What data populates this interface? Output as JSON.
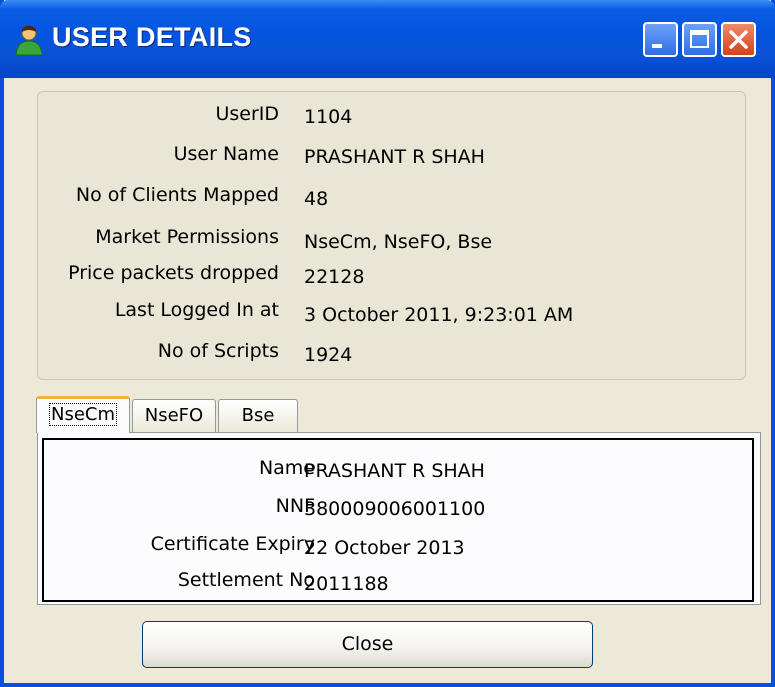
{
  "window": {
    "title": "USER DETAILS"
  },
  "details": [
    {
      "label": "UserID",
      "value": "1104"
    },
    {
      "label": "User Name",
      "value": "PRASHANT R SHAH"
    },
    {
      "label": "No of Clients Mapped",
      "value": "48"
    },
    {
      "label": "Market Permissions",
      "value": "NseCm, NseFO, Bse"
    },
    {
      "label": "Price packets dropped",
      "value": "22128"
    },
    {
      "label": "Last Logged In at",
      "value": "3 October 2011, 9:23:01 AM"
    },
    {
      "label": "No of Scripts",
      "value": "1924"
    }
  ],
  "tabs": [
    {
      "label": "NseCm",
      "active": true
    },
    {
      "label": "NseFO",
      "active": false
    },
    {
      "label": "Bse",
      "active": false
    }
  ],
  "segment": [
    {
      "label": "Name",
      "value": "PRASHANT R SHAH"
    },
    {
      "label": "NNF",
      "value": "380009006001100"
    },
    {
      "label": "Certificate Expiry",
      "value": "22 October 2013"
    },
    {
      "label": "Settlement No",
      "value": "2011188"
    }
  ],
  "buttons": {
    "close_label": "Close"
  },
  "icons": {
    "title": "user-icon",
    "minimize": "minimize-icon",
    "maximize": "maximize-icon",
    "close": "close-icon"
  }
}
